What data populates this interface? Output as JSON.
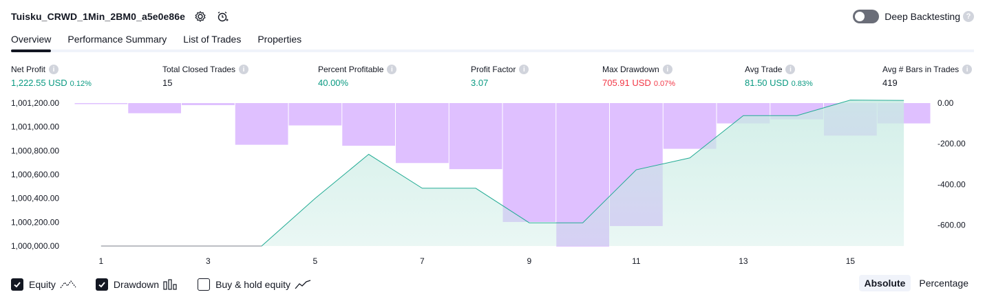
{
  "header": {
    "strategy_name": "Tuisku_CRWD_1Min_2BM0_a5e0e86e",
    "deep_backtesting_label": "Deep Backtesting",
    "deep_backtesting_enabled": false,
    "icons": [
      "settings-icon",
      "alert-icon",
      "help-icon"
    ]
  },
  "tabs": [
    {
      "label": "Overview",
      "active": true
    },
    {
      "label": "Performance Summary",
      "active": false
    },
    {
      "label": "List of Trades",
      "active": false
    },
    {
      "label": "Properties",
      "active": false
    }
  ],
  "metrics": [
    {
      "label": "Net Profit",
      "value": "1,222.55 USD",
      "pct": "0.12%",
      "color": "green"
    },
    {
      "label": "Total Closed Trades",
      "value": "15",
      "pct": "",
      "color": "dark"
    },
    {
      "label": "Percent Profitable",
      "value": "40.00%",
      "pct": "",
      "color": "green"
    },
    {
      "label": "Profit Factor",
      "value": "3.07",
      "pct": "",
      "color": "green"
    },
    {
      "label": "Max Drawdown",
      "value": "705.91 USD",
      "pct": "0.07%",
      "color": "red"
    },
    {
      "label": "Avg Trade",
      "value": "81.50 USD",
      "pct": "0.83%",
      "color": "green"
    },
    {
      "label": "Avg # Bars in Trades",
      "value": "419",
      "pct": "",
      "color": "dark"
    }
  ],
  "chart_data": {
    "type": "area",
    "left_axis": {
      "ticks": [
        "1,001,200.00",
        "1,001,000.00",
        "1,000,800.00",
        "1,000,600.00",
        "1,000,400.00",
        "1,000,200.00",
        "1,000,000.00"
      ],
      "range": [
        1000000,
        1001200
      ]
    },
    "right_axis": {
      "ticks": [
        "0.00",
        "-200.00",
        "-400.00",
        "-600.00"
      ],
      "range": [
        -710,
        0
      ]
    },
    "x_ticks": [
      "1",
      "3",
      "5",
      "7",
      "9",
      "11",
      "13",
      "15"
    ],
    "x_range": [
      0.5,
      16.5
    ],
    "series": [
      {
        "name": "Equity",
        "color": "#22ab94",
        "fill": "#c8ebe3",
        "x": [
          1,
          2,
          3,
          4,
          5,
          6,
          7,
          8,
          9,
          10,
          11,
          12,
          13,
          14,
          15,
          16
        ],
        "values": [
          1000000,
          1000000,
          1000000,
          1000000,
          1000400,
          1000770,
          1000485,
          1000485,
          1000195,
          1000195,
          1000640,
          1000740,
          1001095,
          1001095,
          1001225,
          1001222.55
        ]
      },
      {
        "name": "Drawdown",
        "color": "#cc99ff",
        "x": [
          1,
          2,
          3,
          4,
          5,
          6,
          7,
          8,
          9,
          10,
          11,
          12,
          13,
          14,
          15,
          16
        ],
        "values": [
          0,
          -50,
          -10,
          -205,
          -110,
          -210,
          -295,
          -325,
          -585,
          -705.91,
          -605,
          -225,
          -100,
          -80,
          -160,
          -100
        ]
      }
    ]
  },
  "footer": {
    "checkboxes": [
      {
        "label": "Equity",
        "checked": true,
        "icon": "equity-line-icon"
      },
      {
        "label": "Drawdown",
        "checked": true,
        "icon": "drawdown-bars-icon"
      },
      {
        "label": "Buy & hold equity",
        "checked": false,
        "icon": "buy-hold-line-icon"
      }
    ],
    "mode_options": [
      "Absolute",
      "Percentage"
    ],
    "mode_selected": "Absolute"
  }
}
